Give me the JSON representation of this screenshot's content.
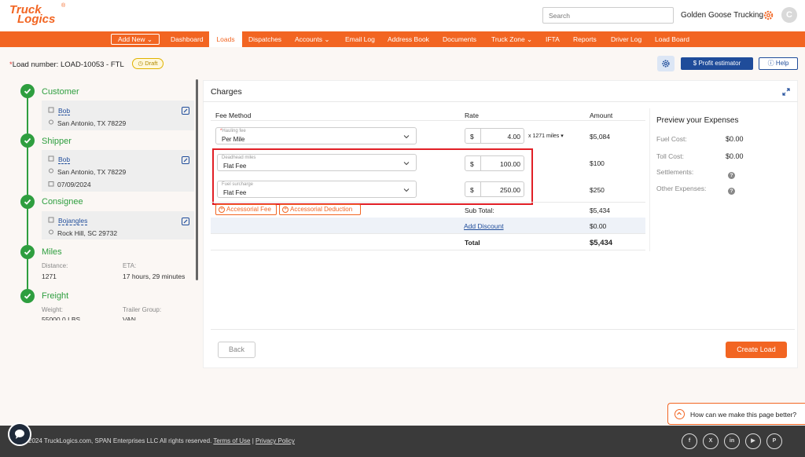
{
  "header": {
    "logo_line1": "Truck",
    "logo_line2": "Logics",
    "logo_mark": "®",
    "search_placeholder": "Search",
    "company": "Golden Goose Trucking",
    "avatar_initial": "C"
  },
  "nav": {
    "add_new": "Add New",
    "items": [
      "Dashboard",
      "Loads",
      "Dispatches",
      "Accounts",
      "Email Log",
      "Address Book",
      "Documents",
      "Truck Zone",
      "IFTA",
      "Reports",
      "Driver Log",
      "Load Board"
    ],
    "active": "Loads"
  },
  "load": {
    "asterisk": "*",
    "label": "Load number:",
    "number": "LOAD-10053 - FTL",
    "status": "Draft"
  },
  "actions": {
    "profit_estimator": "Profit estimator",
    "help": "Help"
  },
  "sidebar": {
    "customer": {
      "title": "Customer",
      "name": "Bob",
      "address": "San Antonio, TX 78229"
    },
    "shipper": {
      "title": "Shipper",
      "name": "Bob",
      "address": "San Antonio, TX 78229",
      "date": "07/09/2024"
    },
    "consignee": {
      "title": "Consignee",
      "name": "Bojangles",
      "address": "Rock Hill, SC 29732"
    },
    "miles": {
      "title": "Miles",
      "distance_label": "Distance:",
      "distance": "1271",
      "eta_label": "ETA:",
      "eta": "17 hours, 29 minutes"
    },
    "freight": {
      "title": "Freight",
      "weight_label": "Weight:",
      "weight": "55000.0 LBS",
      "trailer_label": "Trailer Group:",
      "trailer": "VAN"
    }
  },
  "charges": {
    "title": "Charges",
    "headers": {
      "fee_method": "Fee Method",
      "rate": "Rate",
      "amount": "Amount"
    },
    "rows": [
      {
        "label": "Hauling fee",
        "required": "*",
        "method": "Per Mile",
        "currency": "$",
        "rate": "4.00",
        "multiplier": "x 1271 miles",
        "amount": "$5,084"
      },
      {
        "label": "Deadhead miles",
        "method": "Flat Fee",
        "currency": "$",
        "rate": "100.00",
        "amount": "$100"
      },
      {
        "label": "Fuel surcharge",
        "method": "Flat Fee",
        "currency": "$",
        "rate": "250.00",
        "amount": "$250"
      }
    ],
    "accessorial_fee": "Accessorial Fee",
    "accessorial_deduction": "Accessorial Deduction",
    "subtotal_label": "Sub Total:",
    "subtotal": "$5,434",
    "add_discount": "Add Discount",
    "discount": "$0.00",
    "total_label": "Total",
    "total": "$5,434"
  },
  "preview": {
    "title": "Preview your Expenses",
    "fuel_label": "Fuel Cost:",
    "fuel": "$0.00",
    "toll_label": "Toll Cost:",
    "toll": "$0.00",
    "settlements_label": "Settlements:",
    "other_label": "Other Expenses:"
  },
  "buttons": {
    "back": "Back",
    "create": "Create Load"
  },
  "feedback": "How can we make this page better?",
  "footer": {
    "copyright": "2024 TruckLogics.com, SPAN Enterprises LLC All rights reserved.",
    "terms": "Terms of Use",
    "separator": "|",
    "privacy": "Privacy Policy"
  },
  "social_icons": [
    "facebook-icon",
    "x-icon",
    "linkedin-icon",
    "youtube-icon",
    "pinterest-icon"
  ],
  "colors": {
    "brand_orange": "#f26522",
    "success_green": "#2e9e3f",
    "primary_blue": "#1f4c9a",
    "highlight_red": "#e11f26"
  }
}
